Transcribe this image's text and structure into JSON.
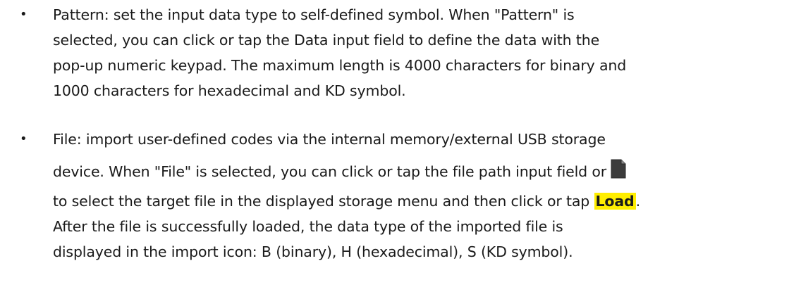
{
  "bullets": {
    "pattern": {
      "line1": "Pattern: set the input data type to self-defined symbol. When \"Pattern\" is",
      "line2": "selected, you can click or tap the Data input field to define the data with the",
      "line3": "pop-up numeric keypad. The maximum length is 4000 characters for binary and",
      "line4": "1000 characters for hexadecimal and KD symbol."
    },
    "file": {
      "line1": "File: import user-defined codes via the internal memory/external USB storage",
      "line2": "device. When \"File\" is selected, you can click or tap the file path input field or",
      "line3_before": "to select the target file in the displayed storage menu and then click or tap ",
      "load_label": "Load",
      "line3_after": ".",
      "line4": "After the file is successfully loaded, the data type of the imported file is",
      "line5": "displayed in the import icon: B (binary), H (hexadecimal), S (KD symbol)."
    }
  },
  "bullet_glyph": "•",
  "icons": {
    "file_icon": "document-file-icon"
  },
  "colors": {
    "highlight": "#ffee00",
    "text": "#1a1a1a",
    "icon_fill": "#3c3c3c"
  }
}
